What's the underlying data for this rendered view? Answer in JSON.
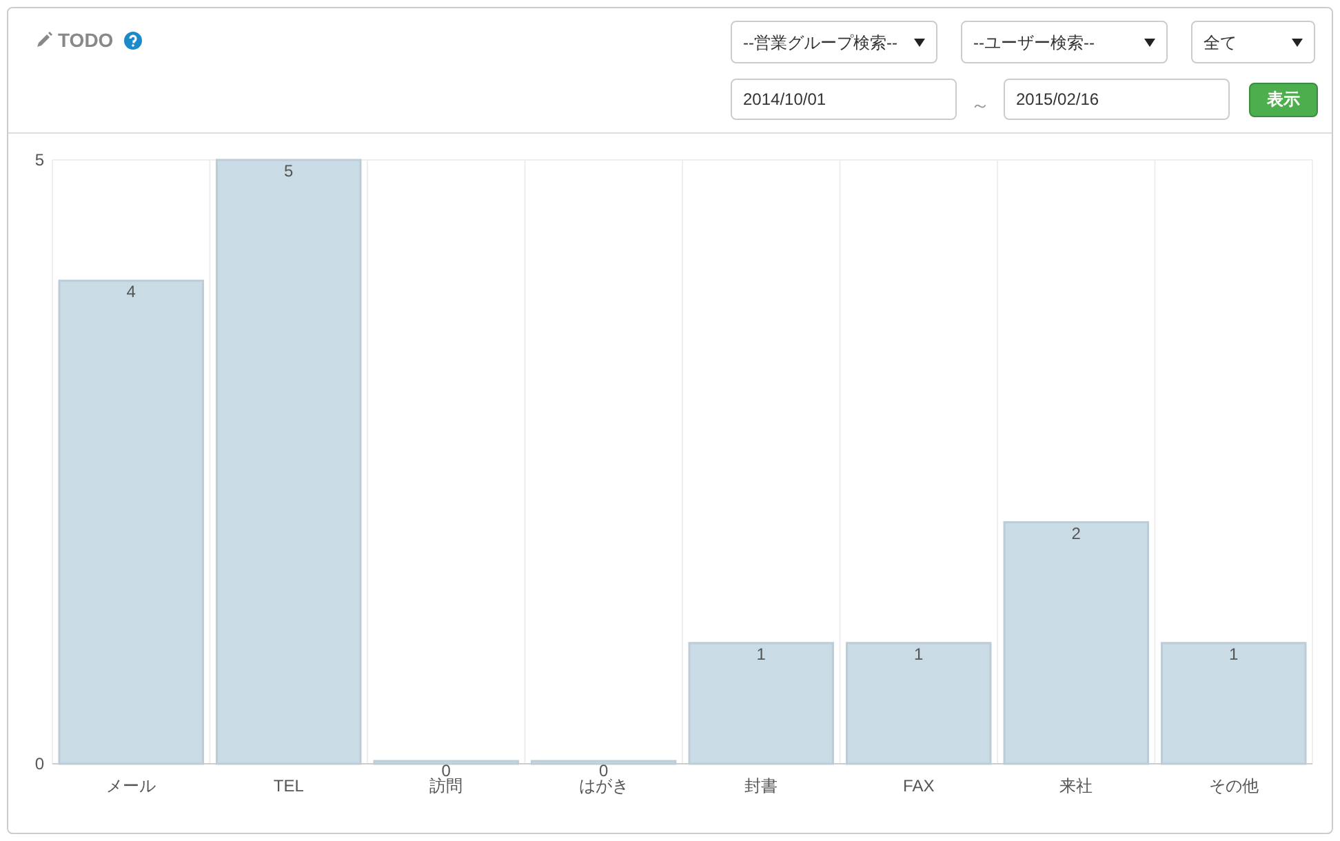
{
  "header": {
    "title": "TODO"
  },
  "filters": {
    "group_select": {
      "value": "--営業グループ検索--"
    },
    "user_select": {
      "value": "--ユーザー検索--"
    },
    "scope_select": {
      "value": "全て"
    },
    "date_from": {
      "value": "2014/10/01"
    },
    "range_separator": "～",
    "date_to": {
      "value": "2015/02/16"
    },
    "show_button": "表示"
  },
  "chart_data": {
    "type": "bar",
    "categories": [
      "メール",
      "TEL",
      "訪問",
      "はがき",
      "封書",
      "FAX",
      "来社",
      "その他"
    ],
    "series": [
      {
        "color": "#c9dbe5",
        "values": [
          4,
          5,
          0,
          0,
          1,
          1,
          2,
          1
        ]
      }
    ],
    "ylim": [
      0,
      5
    ],
    "yticks": [
      0,
      5
    ],
    "data_labels": true
  }
}
